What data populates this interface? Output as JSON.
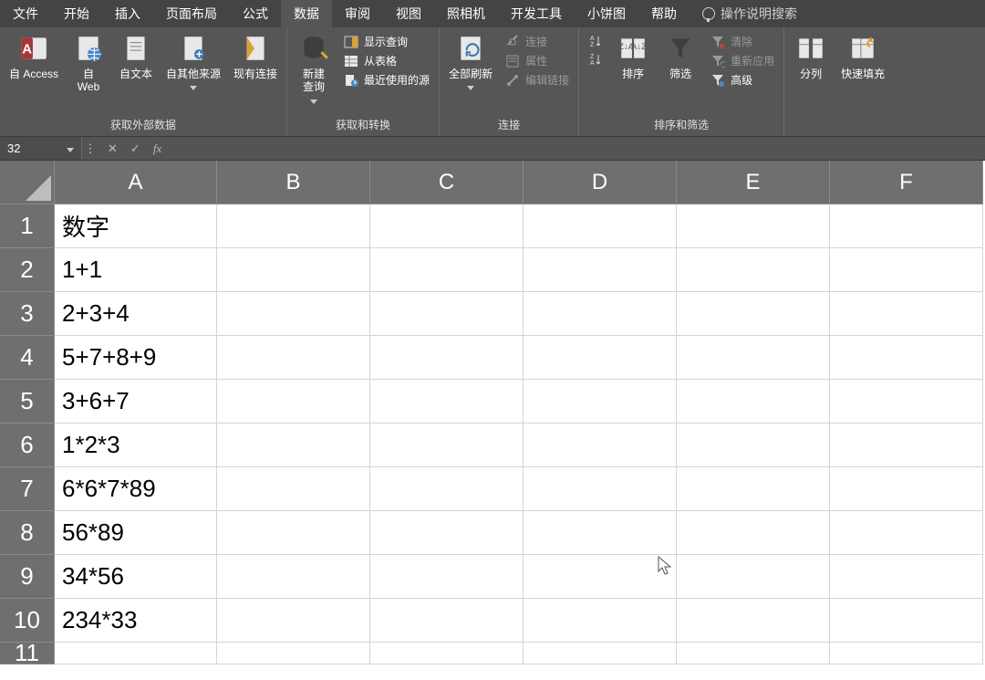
{
  "tabs": {
    "items": [
      "文件",
      "开始",
      "插入",
      "页面布局",
      "公式",
      "数据",
      "审阅",
      "视图",
      "照相机",
      "开发工具",
      "小饼图",
      "帮助"
    ],
    "active_index": 5,
    "tell_me": "操作说明搜索"
  },
  "ribbon": {
    "group1": {
      "label": "获取外部数据",
      "btn_access": "自 Access",
      "btn_web": "自\nWeb",
      "btn_text": "自文本",
      "btn_other": "自其他来源",
      "btn_existing": "现有连接"
    },
    "group2": {
      "label": "获取和转换",
      "btn_newquery": "新建\n查询",
      "item_showq": "显示查询",
      "item_fromtable": "从表格",
      "item_recent": "最近使用的源"
    },
    "group3": {
      "label": "连接",
      "btn_refresh": "全部刷新",
      "item_conn": "连接",
      "item_prop": "属性",
      "item_edit": "编辑链接"
    },
    "group4": {
      "label": "排序和筛选",
      "btn_sort": "排序",
      "btn_filter": "筛选",
      "item_clear": "清除",
      "item_reapply": "重新应用",
      "item_adv": "高级"
    },
    "group5": {
      "btn_cols": "分列",
      "btn_flash": "快速填充"
    }
  },
  "formula_bar": {
    "namebox": "32",
    "fx_label": "fx",
    "input": ""
  },
  "sheet": {
    "col_headers": [
      "A",
      "B",
      "C",
      "D",
      "E",
      "F"
    ],
    "row_headers": [
      "1",
      "2",
      "3",
      "4",
      "5",
      "6",
      "7",
      "8",
      "9",
      "10",
      "11"
    ],
    "colA": [
      "数字",
      "1+1",
      "2+3+4",
      "5+7+8+9",
      "3+6+7",
      "1*2*3",
      "6*6*7*89",
      "56*89",
      "34*56",
      "234*33",
      ""
    ]
  }
}
